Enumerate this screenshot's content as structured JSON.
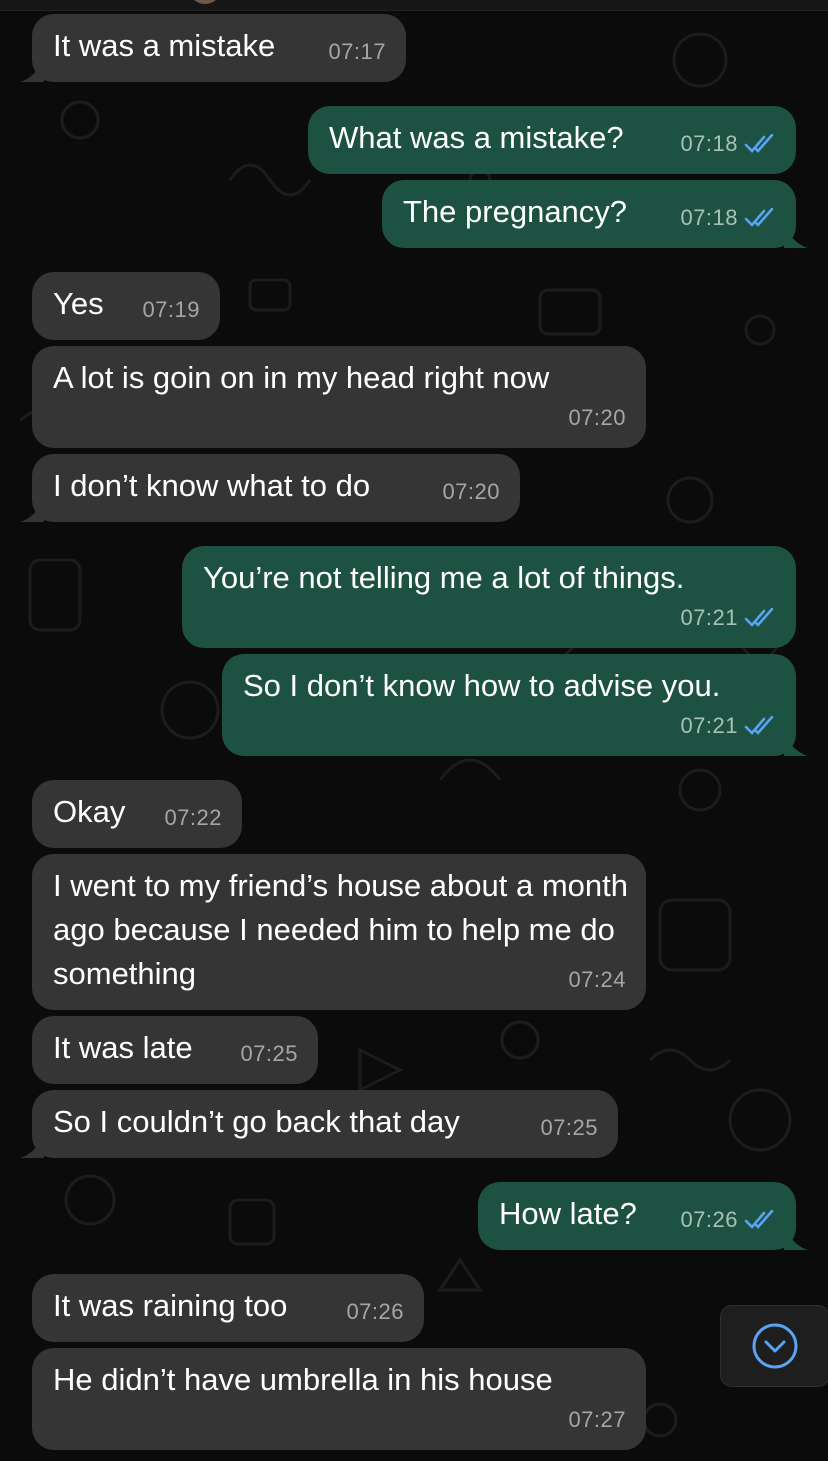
{
  "colors": {
    "background": "#0b0b0b",
    "incoming_bubble": "#353535",
    "outgoing_bubble": "#1d5243",
    "read_ticks": "#5aa3f0",
    "scroll_button": "#1e1e1e"
  },
  "messages": [
    {
      "dir": "in",
      "text": "It was a mistake",
      "time": "07:17"
    },
    {
      "dir": "out",
      "text": "What was a mistake?",
      "time": "07:18",
      "status": "read"
    },
    {
      "dir": "out",
      "text": "The pregnancy?",
      "time": "07:18",
      "status": "read"
    },
    {
      "dir": "in",
      "text": "Yes",
      "time": "07:19"
    },
    {
      "dir": "in",
      "text": "A lot is goin on in my head right now",
      "time": "07:20"
    },
    {
      "dir": "in",
      "text": "I don’t know what to do",
      "time": "07:20"
    },
    {
      "dir": "out",
      "text": "You’re not telling me a lot of things.",
      "time": "07:21",
      "status": "read"
    },
    {
      "dir": "out",
      "text": "So I don’t know how to advise you.",
      "time": "07:21",
      "status": "read"
    },
    {
      "dir": "in",
      "text": "Okay",
      "time": "07:22"
    },
    {
      "dir": "in",
      "text": "I went to my friend’s house about a month ago because I needed him to help me do something",
      "time": "07:24"
    },
    {
      "dir": "in",
      "text": "It was late",
      "time": "07:25"
    },
    {
      "dir": "in",
      "text": "So I couldn’t go back that day",
      "time": "07:25"
    },
    {
      "dir": "out",
      "text": "How late?",
      "time": "07:26",
      "status": "read"
    },
    {
      "dir": "in",
      "text": "It was raining too",
      "time": "07:26"
    },
    {
      "dir": "in",
      "text": "He didn’t have umbrella in his house",
      "time": "07:27"
    }
  ],
  "icons": {
    "read_receipt": "double-check-icon",
    "scroll_down": "chevron-down-circle-icon"
  }
}
